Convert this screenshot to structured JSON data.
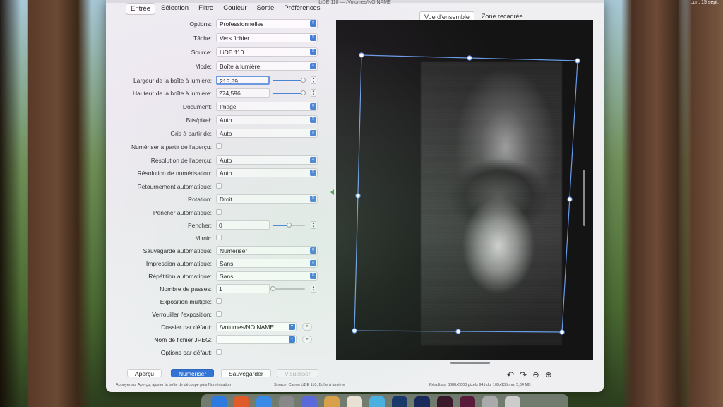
{
  "window": {
    "title": "LiDE 110 — /Volumes/NO NAME"
  },
  "menubar": {
    "clock": "Lun. 15 sept."
  },
  "top_tabs": [
    "Entrée",
    "Sélection",
    "Filtre",
    "Couleur",
    "Sortie",
    "Préférences"
  ],
  "view_tabs": [
    "Vue d'ensemble",
    "Zone recadrée"
  ],
  "form": {
    "options": {
      "label": "Options:",
      "value": "Professionnelles"
    },
    "tache": {
      "label": "Tâche:",
      "value": "Vers fichier"
    },
    "source": {
      "label": "Source:",
      "value": "LiDE 110"
    },
    "mode": {
      "label": "Mode:",
      "value": "Boîte à lumière"
    },
    "largeur": {
      "label": "Largeur de la boîte à lumière:",
      "value": "215,89",
      "slider": 0.95
    },
    "hauteur": {
      "label": "Hauteur de la boîte à lumière:",
      "value": "274,596",
      "slider": 0.95
    },
    "document": {
      "label": "Document:",
      "value": "Image"
    },
    "bits": {
      "label": "Bits/pixel:",
      "value": "Auto"
    },
    "gris": {
      "label": "Gris à partir de:",
      "value": "Auto"
    },
    "numeriser_apercu": {
      "label": "Numériser à partir de l'aperçu:"
    },
    "resolution_apercu": {
      "label": "Résolution de l'aperçu:",
      "value": "Auto"
    },
    "resolution_num": {
      "label": "Résolution de numérisation:",
      "value": "Auto"
    },
    "retournement": {
      "label": "Retournement automatique:"
    },
    "rotation": {
      "label": "Rotation:",
      "value": "Droit"
    },
    "pencher_auto": {
      "label": "Pencher automatique:"
    },
    "pencher": {
      "label": "Pencher:",
      "value": "0",
      "slider": 0.5
    },
    "miroir": {
      "label": "Miroir:"
    },
    "sauvegarde": {
      "label": "Sauvegarde automatique:",
      "value": "Numériser"
    },
    "impression": {
      "label": "Impression automatique:",
      "value": "Sans"
    },
    "repetition": {
      "label": "Répétition automatique:",
      "value": "Sans"
    },
    "passes": {
      "label": "Nombre de passes:",
      "value": "1",
      "slider": 0.0
    },
    "exposition_multiple": {
      "label": "Exposition multiple:"
    },
    "verrouiller": {
      "label": "Verrouiller l'exposition:"
    },
    "dossier": {
      "label": "Dossier par défaut:",
      "value": "/Volumes/NO NAME"
    },
    "nom_jpeg": {
      "label": "Nom de fichier JPEG:",
      "value": ""
    },
    "options_defaut": {
      "label": "Options par défaut:"
    }
  },
  "buttons": {
    "apercu": "Aperçu",
    "numeriser": "Numériser",
    "sauvegarder": "Sauvegarder",
    "visualiser": "Visualiser"
  },
  "status": {
    "left": "Appuyer sur Aperçu, ajuster la boîte de découpe puis Numérisation",
    "center": "Source: Canon LiDE 110, Boîte à lumière",
    "right": "Résultats: 3888x5008 pixels 941 dpi 105x135 mm 5,84 MB"
  },
  "colors": {
    "accent": "#3b7bd6",
    "primary_button": "#2f6fd6",
    "crop_line": "#6a9ae8"
  }
}
